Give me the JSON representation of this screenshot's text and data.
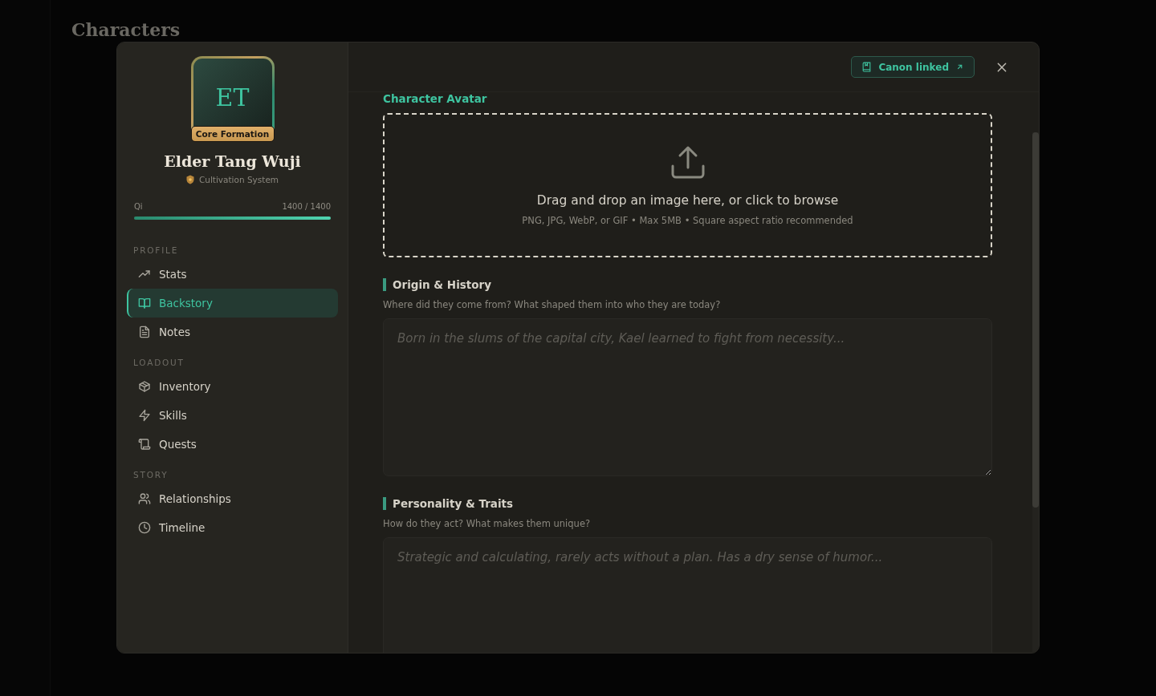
{
  "background": {
    "title": "Characters"
  },
  "profile": {
    "initials": "ET",
    "rank": "Core Formation",
    "name": "Elder Tang Wuji",
    "system": "Cultivation System",
    "resource": {
      "label": "Qi",
      "reading": "1400 / 1400",
      "level": 1
    }
  },
  "nav": [
    {
      "heading": "PROFILE",
      "items": [
        {
          "label": "Stats",
          "selected": false
        },
        {
          "label": "Backstory",
          "selected": true
        },
        {
          "label": "Notes",
          "selected": false
        }
      ]
    },
    {
      "heading": "LOADOUT",
      "items": [
        {
          "label": "Inventory",
          "selected": false
        },
        {
          "label": "Skills",
          "selected": false
        },
        {
          "label": "Quests",
          "selected": false
        }
      ]
    },
    {
      "heading": "STORY",
      "items": [
        {
          "label": "Relationships",
          "selected": false
        },
        {
          "label": "Timeline",
          "selected": false
        }
      ]
    }
  ],
  "header": {
    "canon_button": "Canon linked"
  },
  "avatar_upload": {
    "label": "Character Avatar",
    "prompt": "Drag and drop an image here, or click to browse",
    "hint": "PNG, JPG, WebP, or GIF • Max 5MB • Square aspect ratio recommended"
  },
  "sections": [
    {
      "title": "Origin & History",
      "description": "Where did they come from? What shaped them into who they are today?",
      "placeholder": "Born in the slums of the capital city, Kael learned to fight from necessity..."
    },
    {
      "title": "Personality & Traits",
      "description": "How do they act? What makes them unique?",
      "placeholder": "Strategic and calculating, rarely acts without a plan. Has a dry sense of humor..."
    }
  ]
}
